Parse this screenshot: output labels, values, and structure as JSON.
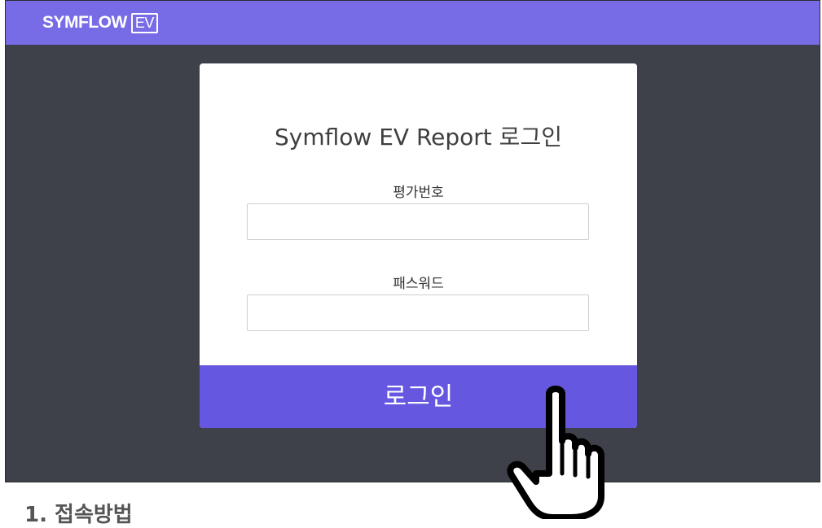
{
  "header": {
    "logo_text": "SYMFLOW",
    "logo_badge": "EV"
  },
  "login": {
    "title": "Symflow EV Report 로그인",
    "eval_number_label": "평가번호",
    "eval_number_value": "",
    "password_label": "패스워드",
    "password_value": "",
    "login_button": "로그인"
  },
  "caption": {
    "text": "1. 접속방법"
  },
  "colors": {
    "topbar": "#776ce6",
    "background": "#3e4149",
    "button": "#6657e0",
    "card": "#ffffff"
  },
  "icons": {
    "cursor": "hand-pointer-icon"
  }
}
